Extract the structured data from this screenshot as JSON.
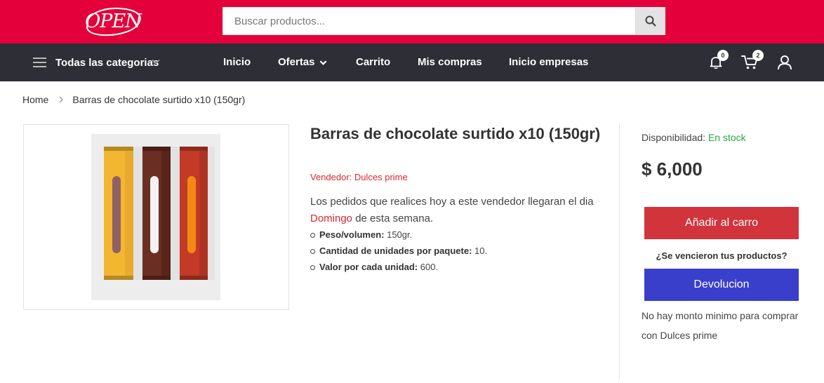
{
  "header": {
    "logo_text": "OPEN",
    "search": {
      "placeholder": "Buscar productos..."
    },
    "brand_color": "#e4003a"
  },
  "nav": {
    "categories_label": "Todas las categorias",
    "items": [
      {
        "label": "Inicio"
      },
      {
        "label": "Ofertas",
        "has_dropdown": true
      },
      {
        "label": "Carrito"
      },
      {
        "label": "Mis compras"
      },
      {
        "label": "Inicio empresas"
      }
    ],
    "notifications_count": "0",
    "cart_count": "2",
    "background": "#2e2f36"
  },
  "breadcrumb": {
    "home": "Home",
    "current": "Barras de chocolate surtido x10 (150gr)"
  },
  "product": {
    "title": "Barras de chocolate surtido x10 (150gr)",
    "seller": "Vendedor: Dulces prime",
    "delivery_text": "Los pedidos que realices hoy a este vendedor llegaran el dia",
    "delivery_day": "Domingo",
    "delivery_suffix": "de esta semana.",
    "specs": [
      {
        "label": "Peso/volumen:",
        "value": "150gr."
      },
      {
        "label": "Cantidad de unidades por paquete:",
        "value": "10."
      },
      {
        "label": "Valor por cada unidad:",
        "value": "600."
      }
    ]
  },
  "sidebar": {
    "availability_label": "Disponibilidad:",
    "availability_value": "En stock",
    "price": "$ 6,000",
    "add_to_cart": "Añadir al carro",
    "expired_question": "¿Se vencieron tus productos?",
    "return_button": "Devolucion",
    "minimum_note": "No hay monto minimo para comprar con Dulces prime"
  }
}
